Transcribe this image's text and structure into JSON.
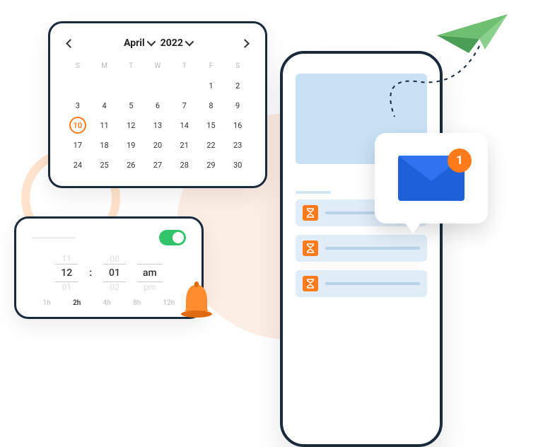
{
  "calendar": {
    "month": "April",
    "year": "2022",
    "dow": [
      "S",
      "M",
      "T",
      "W",
      "T",
      "F",
      "S"
    ],
    "days": [
      "1",
      "2",
      "3",
      "4",
      "5",
      "6",
      "7",
      "8",
      "9",
      "10",
      "11",
      "12",
      "13",
      "14",
      "15",
      "16",
      "17",
      "18",
      "19",
      "20",
      "21",
      "22",
      "23",
      "24",
      "25",
      "26",
      "27",
      "28",
      "29",
      "30"
    ],
    "selected": "10"
  },
  "time": {
    "hour_above": "11",
    "hour": "12",
    "hour_below": "01",
    "min_above": "00",
    "min": "01",
    "min_below": "02",
    "ampm": "am",
    "ampm_below": "pm",
    "durations": [
      "1h",
      "2h",
      "4h",
      "8h",
      "12h"
    ],
    "duration_active": "2h",
    "toggle_on": true
  },
  "mail": {
    "badge": "1"
  }
}
